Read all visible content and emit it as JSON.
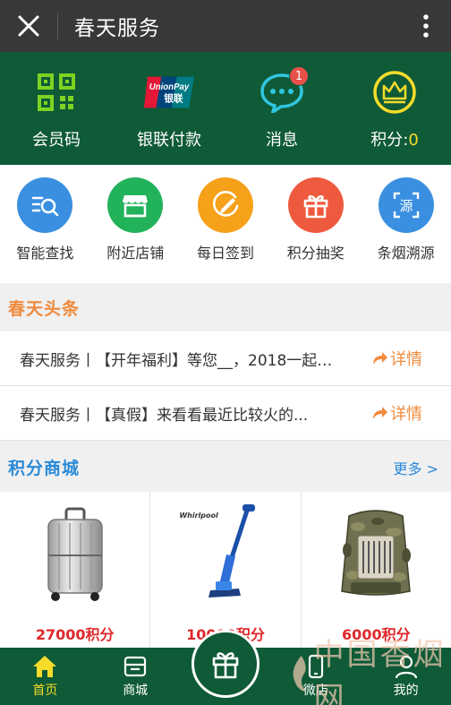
{
  "titlebar": {
    "title": "春天服务",
    "close_icon": "close-icon",
    "more_icon": "vertical-dots-icon"
  },
  "top_actions": [
    {
      "label": "会员码",
      "icon": "qr-code-icon"
    },
    {
      "label": "银联付款",
      "icon": "unionpay-logo",
      "logo_text_top": "UnionPay",
      "logo_text_bottom": "银联"
    },
    {
      "label": "消息",
      "icon": "chat-bubble-icon",
      "badge": "1"
    },
    {
      "label": "积分:",
      "value": "0",
      "icon": "crown-icon"
    }
  ],
  "quick_actions": [
    {
      "label": "智能查找",
      "icon": "search-list-icon",
      "color": "#3a8fe0"
    },
    {
      "label": "附近店铺",
      "icon": "store-icon",
      "color": "#22b25a"
    },
    {
      "label": "每日签到",
      "icon": "pencil-icon",
      "color": "#f5a11a"
    },
    {
      "label": "积分抽奖",
      "icon": "gift-icon",
      "color": "#ee5a3d"
    },
    {
      "label": "条烟溯源",
      "icon": "trace-source-icon",
      "color": "#3a8fe0",
      "icon_text": "源"
    }
  ],
  "news": {
    "title": "春天头条",
    "items": [
      {
        "text": "春天服务丨【开年福利】等您__，2018一起…",
        "detail": "详情"
      },
      {
        "text": "春天服务丨【真假】来看看最近比较火的...",
        "detail": "详情"
      }
    ]
  },
  "mall": {
    "title": "积分商城",
    "more": "更多 >",
    "products": [
      {
        "price": "27000积分",
        "image": "silver-suitcase"
      },
      {
        "price": "10000积分",
        "image": "whirlpool-vacuum",
        "brand": "Whirlpool"
      },
      {
        "price": "6000积分",
        "image": "camo-picnic-backpack"
      }
    ]
  },
  "tabbar": [
    {
      "label": "首页",
      "icon": "home-icon",
      "active": true
    },
    {
      "label": "商城",
      "icon": "shop-bag-icon"
    },
    {
      "label": "",
      "icon": "gift-center-icon"
    },
    {
      "label": "微店",
      "icon": "phone-icon"
    },
    {
      "label": "我的",
      "icon": "user-icon"
    }
  ],
  "watermark": "中国香烟网",
  "colors": {
    "title_bar": "#383838",
    "brand_green": "#0f5a37",
    "accent_orange": "#f08a3c",
    "accent_blue": "#2a8ad8",
    "price_red": "#e0282a",
    "points_yellow": "#f5dc2a"
  }
}
